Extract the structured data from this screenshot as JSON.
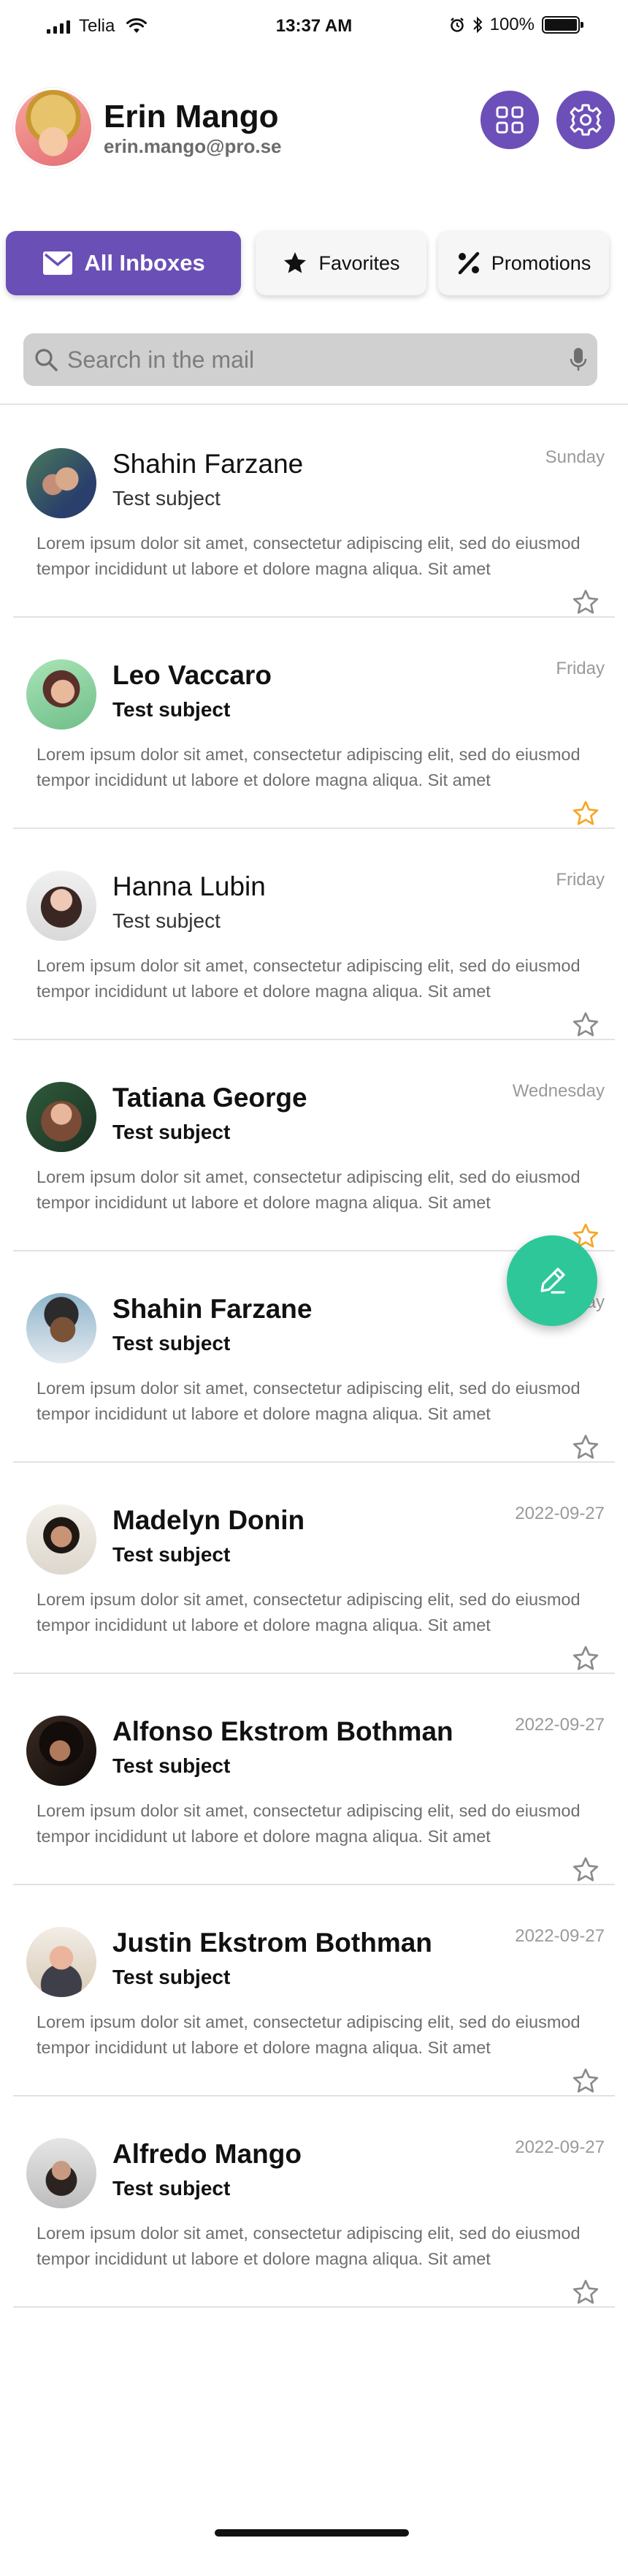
{
  "status_bar": {
    "carrier": "Telia",
    "time": "13:37 AM",
    "battery": "100%",
    "battery_level": 1.0
  },
  "profile": {
    "name": "Erin Mango",
    "email": "erin.mango@pro.se"
  },
  "header_buttons": {
    "apps_icon": "grid-icon",
    "settings_icon": "gear-icon"
  },
  "tabs": [
    {
      "label": "All Inboxes",
      "icon": "envelope-icon",
      "active": true
    },
    {
      "label": "Favorites",
      "icon": "star-icon",
      "active": false
    },
    {
      "label": "Promotions",
      "icon": "percent-icon",
      "active": false
    }
  ],
  "search": {
    "placeholder": "Search in the mail",
    "value": ""
  },
  "mails": [
    {
      "sender": "Shahin Farzane",
      "subject": "Test subject",
      "date": "Sunday",
      "preview": "Lorem ipsum dolor sit amet, consectetur adipiscing elit, sed do eiusmod tempor incididunt ut labore et dolore magna aliqua. Sit amet",
      "unread": false,
      "starred": false
    },
    {
      "sender": "Leo Vaccaro",
      "subject": "Test subject",
      "date": "Friday",
      "preview": "Lorem ipsum dolor sit amet, consectetur adipiscing elit, sed do eiusmod tempor incididunt ut labore et dolore magna aliqua. Sit amet",
      "unread": true,
      "starred": true
    },
    {
      "sender": "Hanna Lubin",
      "subject": "Test subject",
      "date": "Friday",
      "preview": "Lorem ipsum dolor sit amet, consectetur adipiscing elit, sed do eiusmod tempor incididunt ut labore et dolore magna aliqua. Sit amet",
      "unread": false,
      "starred": false
    },
    {
      "sender": "Tatiana George",
      "subject": "Test subject",
      "date": "Wednesday",
      "preview": "Lorem ipsum dolor sit amet, consectetur adipiscing elit, sed do eiusmod tempor incididunt ut labore et dolore magna aliqua. Sit amet",
      "unread": true,
      "starred": true
    },
    {
      "sender": "Shahin Farzane",
      "subject": "Test subject",
      "date": "Tuesday",
      "preview": "Lorem ipsum dolor sit amet, consectetur adipiscing elit, sed do eiusmod tempor incididunt ut labore et dolore magna aliqua. Sit amet",
      "unread": true,
      "starred": false
    },
    {
      "sender": "Madelyn Donin",
      "subject": "Test subject",
      "date": "2022-09-27",
      "preview": "Lorem ipsum dolor sit amet, consectetur adipiscing elit, sed do eiusmod tempor incididunt ut labore et dolore magna aliqua. Sit amet",
      "unread": true,
      "starred": false
    },
    {
      "sender": "Alfonso Ekstrom Bothman",
      "subject": "Test subject",
      "date": "2022-09-27",
      "preview": "Lorem ipsum dolor sit amet, consectetur adipiscing elit, sed do eiusmod tempor incididunt ut labore et dolore magna aliqua. Sit amet",
      "unread": true,
      "starred": false
    },
    {
      "sender": "Justin Ekstrom Bothman",
      "subject": "Test subject",
      "date": "2022-09-27",
      "preview": "Lorem ipsum dolor sit amet, consectetur adipiscing elit, sed do eiusmod tempor incididunt ut labore et dolore magna aliqua. Sit amet",
      "unread": true,
      "starred": false
    },
    {
      "sender": "Alfredo Mango",
      "subject": "Test subject",
      "date": "2022-09-27",
      "preview": "Lorem ipsum dolor sit amet, consectetur adipiscing elit, sed do eiusmod tempor incididunt ut labore et dolore magna aliqua. Sit amet",
      "unread": true,
      "starred": false
    }
  ],
  "fab": {
    "icon": "pencil-icon"
  },
  "colors": {
    "accent": "#6a4fb6",
    "fab": "#2ec79a",
    "star_active": "#f5a623",
    "star_inactive": "#8a8a8a"
  }
}
